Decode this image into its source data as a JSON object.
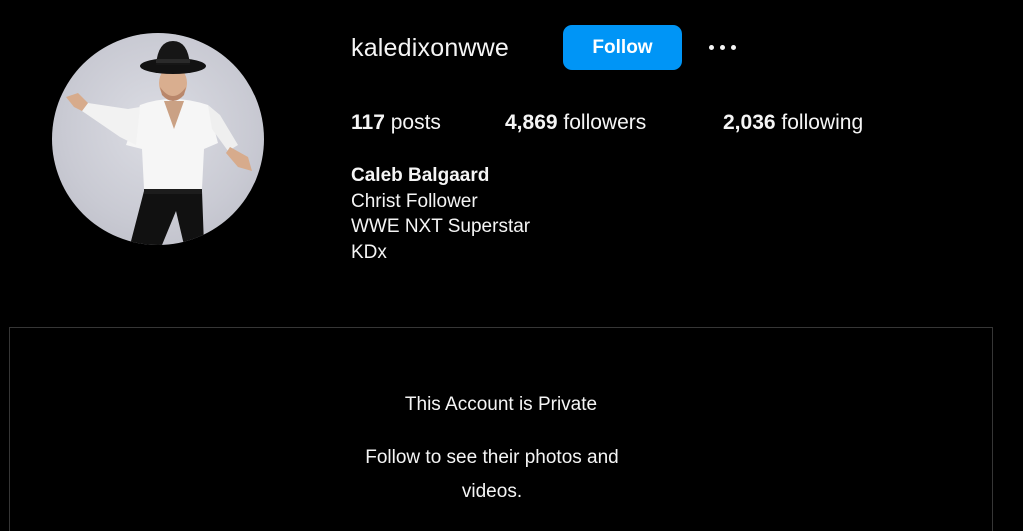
{
  "profile": {
    "username": "kaledixonwwe",
    "avatar_alt": "profile photo",
    "follow_label": "Follow",
    "more_icon": "more-options-icon",
    "accent_color": "#0095f6"
  },
  "stats": {
    "posts_count": "117",
    "posts_label": "posts",
    "followers_count": "4,869",
    "followers_label": "followers",
    "following_count": "2,036",
    "following_label": "following"
  },
  "bio": {
    "name": "Caleb Balgaard",
    "lines": [
      "Christ Follower",
      "WWE NXT Superstar",
      "KDx"
    ]
  },
  "private_notice": {
    "title": "This Account is Private",
    "subtitle": "Follow to see their photos and videos."
  }
}
